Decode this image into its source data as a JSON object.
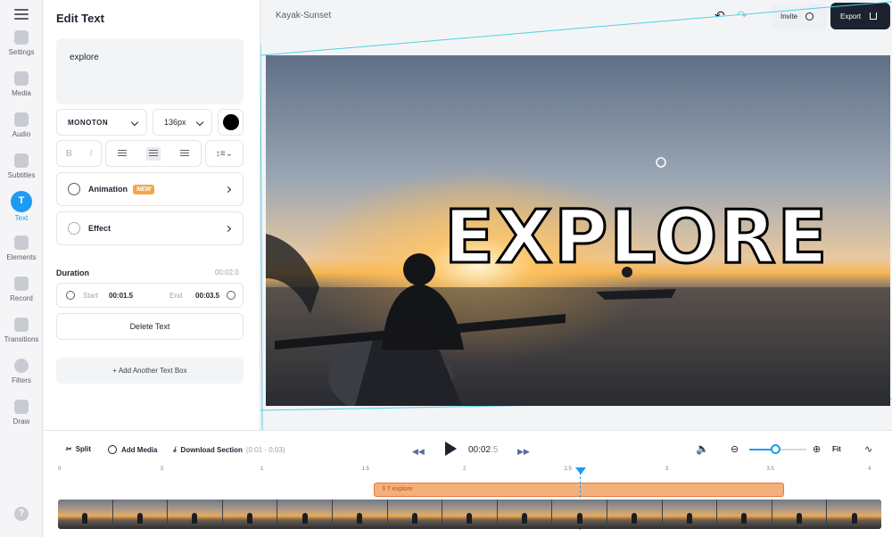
{
  "rail": {
    "items": [
      {
        "label": "Settings"
      },
      {
        "label": "Media"
      },
      {
        "label": "Audio"
      },
      {
        "label": "Subtitles"
      },
      {
        "label": "Text"
      },
      {
        "label": "Elements"
      },
      {
        "label": "Record"
      },
      {
        "label": "Transitions"
      },
      {
        "label": "Filters"
      },
      {
        "label": "Draw"
      }
    ],
    "active": "Text",
    "help": "?"
  },
  "panel": {
    "title": "Edit Text",
    "text_value": "explore",
    "font": "MONOTON",
    "size": "136px",
    "color": "#000000",
    "bold": "B",
    "italic": "I",
    "animation_label": "Animation",
    "animation_badge": "NEW",
    "effect_label": "Effect",
    "duration_label": "Duration",
    "duration_value": "00:02.0",
    "start_label": "Start",
    "start_value": "00:01.5",
    "end_label": "End",
    "end_value": "00:03.5",
    "delete_label": "Delete Text",
    "add_label": "+   Add Another Text Box"
  },
  "topbar": {
    "project_title": "Kayak-Sunset",
    "invite_label": "Invite",
    "export_label": "Export"
  },
  "canvas": {
    "overlay_text": "EXPLORE"
  },
  "timeline": {
    "split_label": "Split",
    "add_media_label": "Add Media",
    "download_label": "Download Section",
    "download_range": "(0:01 - 0:03)",
    "current_time": "00:02",
    "current_frac": ":5",
    "fit_label": "Fit",
    "zoom_level": 0.45,
    "ticks": [
      "0",
      ".5",
      "1",
      "1.5",
      "2",
      "2.5",
      "3",
      "3.5",
      "4"
    ],
    "clip_label": "explore"
  }
}
